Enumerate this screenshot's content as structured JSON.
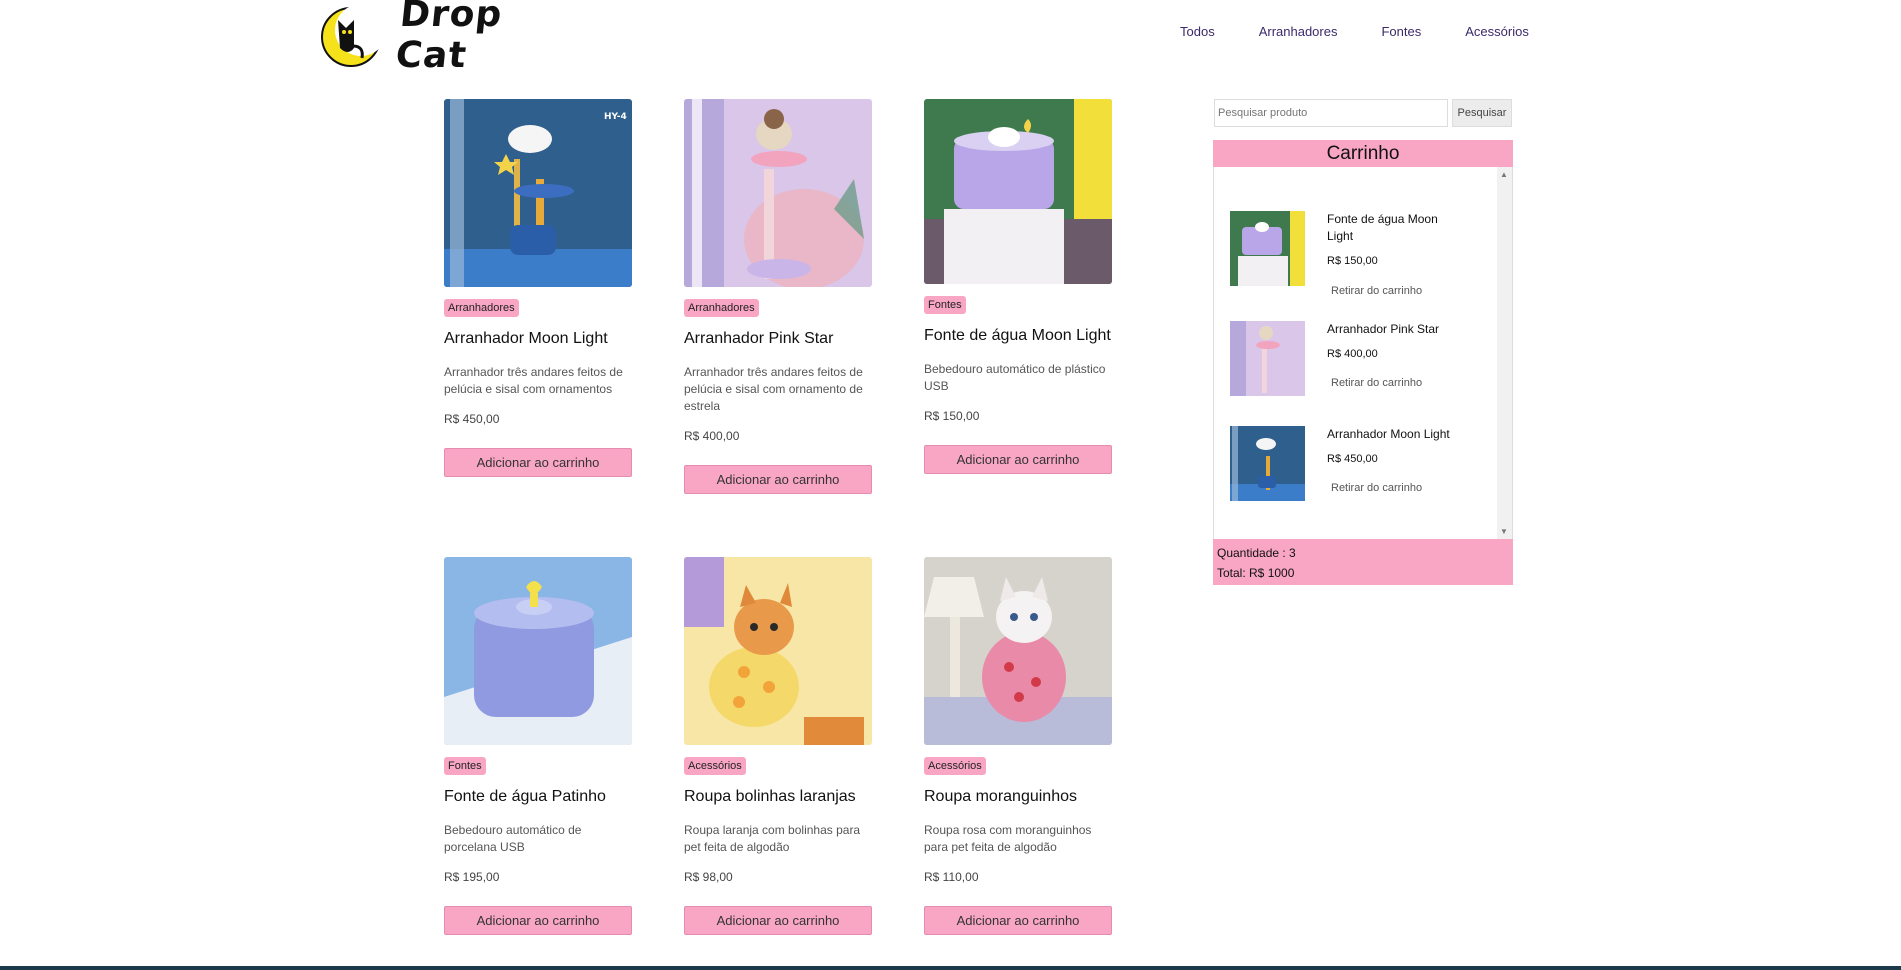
{
  "brand": {
    "name": "Drop Cat"
  },
  "nav": [
    "Todos",
    "Arranhadores",
    "Fontes",
    "Acessórios"
  ],
  "products": [
    {
      "category": "Arranhadores",
      "title": "Arranhador Moon Light",
      "description": "Arranhador três andares feitos de pelúcia e sisal com ornamentos",
      "price": "R$ 450,00",
      "button": "Adicionar ao carrinho",
      "image_tag": "HY-4"
    },
    {
      "category": "Arranhadores",
      "title": "Arranhador Pink Star",
      "description": "Arranhador três andares feitos de pelúcia e sisal com ornamento de estrela",
      "price": "R$ 400,00",
      "button": "Adicionar ao carrinho"
    },
    {
      "category": "Fontes",
      "title": "Fonte de água Moon Light",
      "description": "Bebedouro automático de plástico USB",
      "price": "R$ 150,00",
      "button": "Adicionar ao carrinho"
    },
    {
      "category": "Fontes",
      "title": "Fonte de água Patinho",
      "description": "Bebedouro automático de porcelana USB",
      "price": "R$ 195,00",
      "button": "Adicionar ao carrinho"
    },
    {
      "category": "Acessórios",
      "title": "Roupa bolinhas laranjas",
      "description": "Roupa laranja com bolinhas para pet feita de algodão",
      "price": "R$ 98,00",
      "button": "Adicionar ao carrinho"
    },
    {
      "category": "Acessórios",
      "title": "Roupa moranguinhos",
      "description": "Roupa rosa com moranguinhos para pet feita de algodão",
      "price": "R$ 110,00",
      "button": "Adicionar ao carrinho"
    }
  ],
  "search": {
    "placeholder": "Pesquisar produto",
    "button": "Pesquisar"
  },
  "cart": {
    "title": "Carrinho",
    "items": [
      {
        "name": "Fonte de água Moon Light",
        "price": "R$ 150,00",
        "remove": "Retirar do carrinho"
      },
      {
        "name": "Arranhador Pink Star",
        "price": "R$ 400,00",
        "remove": "Retirar do carrinho"
      },
      {
        "name": "Arranhador Moon Light",
        "price": "R$ 450,00",
        "remove": "Retirar do carrinho"
      }
    ],
    "quantity": "Quantidade : 3",
    "total": "Total: R$ 1000"
  },
  "colors": {
    "accent": "#f9a6c5",
    "nav_text": "#3b2a6b"
  }
}
